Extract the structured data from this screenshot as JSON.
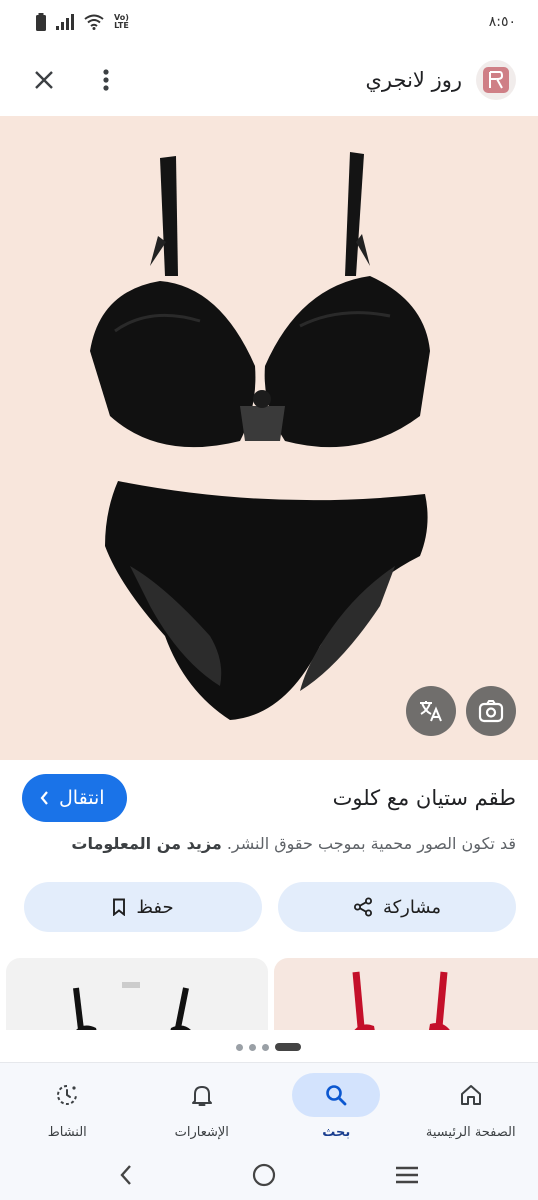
{
  "status_bar": {
    "time": "٨:٥٠",
    "network_badge_top": "Vo)",
    "network_badge_bottom": "LTE"
  },
  "header": {
    "site_name": "روز لانجري",
    "logo_icon": "rose-lingerie-logo",
    "menu_icon": "more-vert-icon",
    "close_icon": "close-icon"
  },
  "image": {
    "alt_subject": "",
    "translate_icon": "translate-icon",
    "lens_icon": "google-lens-icon"
  },
  "product": {
    "title": "طقم ستيان مع كلوت",
    "visit_label": "انتقال",
    "copyright_text": "قد تكون الصور محمية بموجب حقوق النشر.",
    "more_info_label": "مزيد من المعلومات"
  },
  "actions": {
    "share_label": "مشاركة",
    "save_label": "حفظ"
  },
  "bottom_nav": {
    "items": [
      {
        "label": "الصفحة الرئيسية",
        "icon": "home-icon",
        "active": false
      },
      {
        "label": "بحث",
        "icon": "search-icon",
        "active": true
      },
      {
        "label": "الإشعارات",
        "icon": "bell-icon",
        "active": false
      },
      {
        "label": "النشاط",
        "icon": "activity-icon",
        "active": false
      }
    ]
  },
  "colors": {
    "accent": "#1a73e8",
    "image_bg": "#f8e6dc",
    "action_bg": "#e3edfb",
    "nav_active_bg": "#d3e3fd"
  }
}
